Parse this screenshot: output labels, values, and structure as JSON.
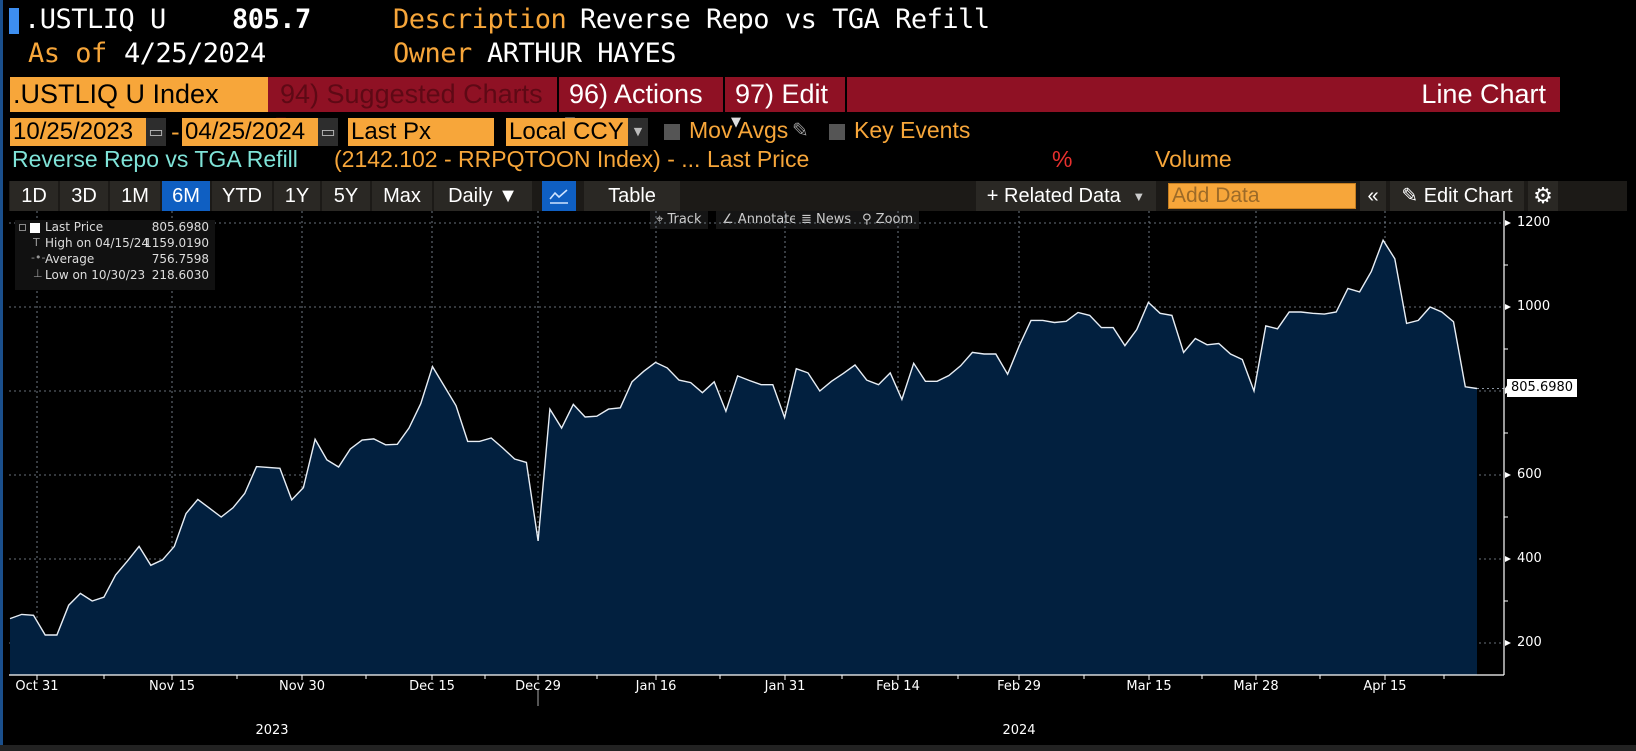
{
  "header": {
    "ticker": ".USTLIQ U",
    "price": "805.7",
    "as_of_label": "As of",
    "as_of_date": "4/25/2024",
    "description_label": "Description",
    "description_value": "Reverse Repo vs TGA Refill",
    "owner_label": "Owner",
    "owner_value": "ARTHUR HAYES"
  },
  "command_bar": {
    "security": ".USTLIQ U Index",
    "suggested_charts": "94) Suggested Charts",
    "actions": "96) Actions",
    "edit": "97) Edit",
    "chart_type": "Line Chart"
  },
  "controls": {
    "start_date": "10/25/2023",
    "date_separator": "-",
    "end_date": "04/25/2024",
    "field": "Last Px",
    "currency": "Local CCY",
    "mov_avgs": "Mov Avgs",
    "key_events": "Key Events"
  },
  "series_info": {
    "name": "Reverse Repo vs TGA Refill",
    "formula": "(2142.102 - RRPQTOON Index) - ...",
    "field": "Last Price",
    "pct": "%",
    "volume": "Volume"
  },
  "tabs": [
    {
      "label": "1D"
    },
    {
      "label": "3D"
    },
    {
      "label": "1M"
    },
    {
      "label": "6M",
      "active": true
    },
    {
      "label": "YTD"
    },
    {
      "label": "1Y"
    },
    {
      "label": "5Y"
    },
    {
      "label": "Max"
    }
  ],
  "toolbar": {
    "frequency": "Daily ▼",
    "table": "Table",
    "related_data": "+ Related Data",
    "add_data_placeholder": "Add Data",
    "collapse": "«",
    "edit_chart": "Edit Chart"
  },
  "chart_tools": {
    "track": "Track",
    "annotate": "Annotate",
    "news": "News",
    "zoom": "Zoom"
  },
  "legend": {
    "rows": [
      {
        "label": "Last Price",
        "value": "805.6980"
      },
      {
        "label": "High on 04/15/24",
        "value": "1159.0190"
      },
      {
        "label": "Average",
        "value": "756.7598"
      },
      {
        "label": "Low on 10/30/23",
        "value": "218.6030"
      }
    ]
  },
  "colors": {
    "accent_orange": "#f7a63a",
    "command_red": "#8f1124",
    "active_tab_blue": "#0f5fc2",
    "area_fill": "#02203f",
    "series_name_cyan": "#7fe3d8",
    "pct_red": "#e8302e"
  },
  "chart_data": {
    "type": "area",
    "title": "Reverse Repo vs TGA Refill",
    "xlabel": "",
    "ylabel": "",
    "ylim": [
      150,
      1230
    ],
    "yticks": [
      200,
      400,
      600,
      800,
      1000,
      1200
    ],
    "xtick_labels": [
      "Oct 31",
      "Nov 15",
      "Nov 30",
      "Dec 15",
      "Dec 29",
      "Jan 16",
      "Jan 31",
      "Feb 14",
      "Feb 29",
      "Mar 15",
      "Mar 28",
      "Apr 15"
    ],
    "year_labels": [
      "2023",
      "2024"
    ],
    "grid": true,
    "last_value_label": "805.6980",
    "series": [
      {
        "name": "Last Price",
        "values": [
          258,
          268,
          266,
          219,
          219,
          290,
          318,
          300,
          309,
          362,
          395,
          430,
          385,
          398,
          430,
          508,
          542,
          521,
          500,
          522,
          556,
          620,
          618,
          616,
          541,
          570,
          685,
          636,
          619,
          662,
          683,
          686,
          672,
          673,
          712,
          770,
          858,
          812,
          765,
          680,
          680,
          688,
          664,
          638,
          630,
          443,
          757,
          712,
          768,
          738,
          740,
          757,
          760,
          822,
          847,
          868,
          855,
          826,
          820,
          796,
          822,
          752,
          836,
          825,
          815,
          815,
          737,
          853,
          843,
          800,
          823,
          842,
          862,
          826,
          815,
          843,
          780,
          866,
          823,
          823,
          837,
          860,
          892,
          888,
          888,
          840,
          908,
          968,
          968,
          963,
          966,
          987,
          980,
          951,
          951,
          908,
          946,
          1011,
          985,
          980,
          892,
          925,
          910,
          913,
          888,
          875,
          800,
          955,
          948,
          988,
          988,
          985,
          983,
          988,
          1044,
          1036,
          1085,
          1159,
          1115,
          961,
          968,
          1000,
          988,
          965,
          810,
          806
        ]
      }
    ],
    "legend_stats": {
      "last": 805.698,
      "high": 1159.019,
      "high_date": "04/15/24",
      "average": 756.7598,
      "low": 218.603,
      "low_date": "10/30/23"
    }
  }
}
